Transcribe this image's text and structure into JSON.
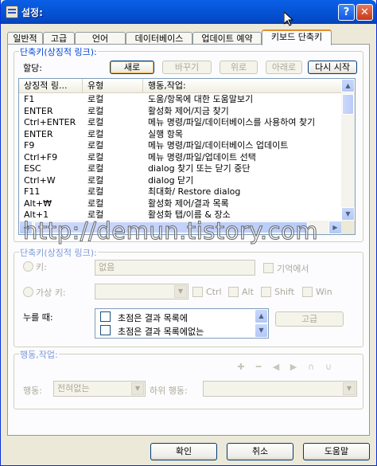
{
  "window": {
    "title": "설정:"
  },
  "tabs": [
    {
      "label": "일반적"
    },
    {
      "label": "고급"
    },
    {
      "label": "언어"
    },
    {
      "label": "데이터베이스"
    },
    {
      "label": "업데이트 예약"
    },
    {
      "label": "키보드 단축키"
    }
  ],
  "shortcuts_group": {
    "title": "단축키(상징적 링크):",
    "assign_label": "할당:",
    "buttons": {
      "new": "새로",
      "change": "바꾸기",
      "up": "위로",
      "down": "아래로",
      "restart": "다시 시작"
    },
    "columns": [
      "상징적 링...",
      "유형",
      "행동,작업:"
    ],
    "rows": [
      [
        "F1",
        "로컬",
        "도움/항목에 대한 도움말보기"
      ],
      [
        "ENTER",
        "로컬",
        "활성화 제어/지금 찾기"
      ],
      [
        "Ctrl+ENTER",
        "로컬",
        "메뉴 명령/파일/데이터베이스를 사용하여 찾기"
      ],
      [
        "ENTER",
        "로컬",
        "실행 항목"
      ],
      [
        "F9",
        "로컬",
        "메뉴 명령/파일/데이터베이스 업데이트"
      ],
      [
        "Ctrl+F9",
        "로컬",
        "메뉴 명령/파일/업데이트 선택"
      ],
      [
        "ESC",
        "로컬",
        "dialog 찾기 또는 닫기 중단"
      ],
      [
        "Ctrl+W",
        "로컬",
        "dialog 닫기"
      ],
      [
        "F11",
        "로컬",
        "최대화/ Restore dialog"
      ],
      [
        "Alt+₩",
        "로컬",
        "활성화 제어/결과 목록"
      ],
      [
        "Alt+1",
        "로컬",
        "활성화 탭/이름 & 장소"
      ]
    ]
  },
  "hotkey_group": {
    "title": "단축키(상징적 링크):",
    "key_label": "키:",
    "key_value": "없음",
    "remember_label": "기억에서",
    "virtual_key_label": "가상 키:",
    "modifiers": [
      "Ctrl",
      "Alt",
      "Shift",
      "Win"
    ],
    "when_pressed_label": "누를 때:",
    "conditions": [
      "초점은 결과 목록에",
      "초점은 결과 목록에없는"
    ],
    "advanced_button": "고급"
  },
  "action_group": {
    "title": "행동,작업:",
    "action_label": "행동:",
    "action_value": "전혀없는",
    "sub_action_label": "하위 행동:",
    "sub_action_value": ""
  },
  "watermark": "http://demun.tistory.com",
  "footer": {
    "ok": "확인",
    "cancel": "취소",
    "help": "도움말"
  },
  "colors": {
    "accent_tab": "#e68b2c",
    "group_title": "#0046d5",
    "title_bar": "#0756d8"
  }
}
